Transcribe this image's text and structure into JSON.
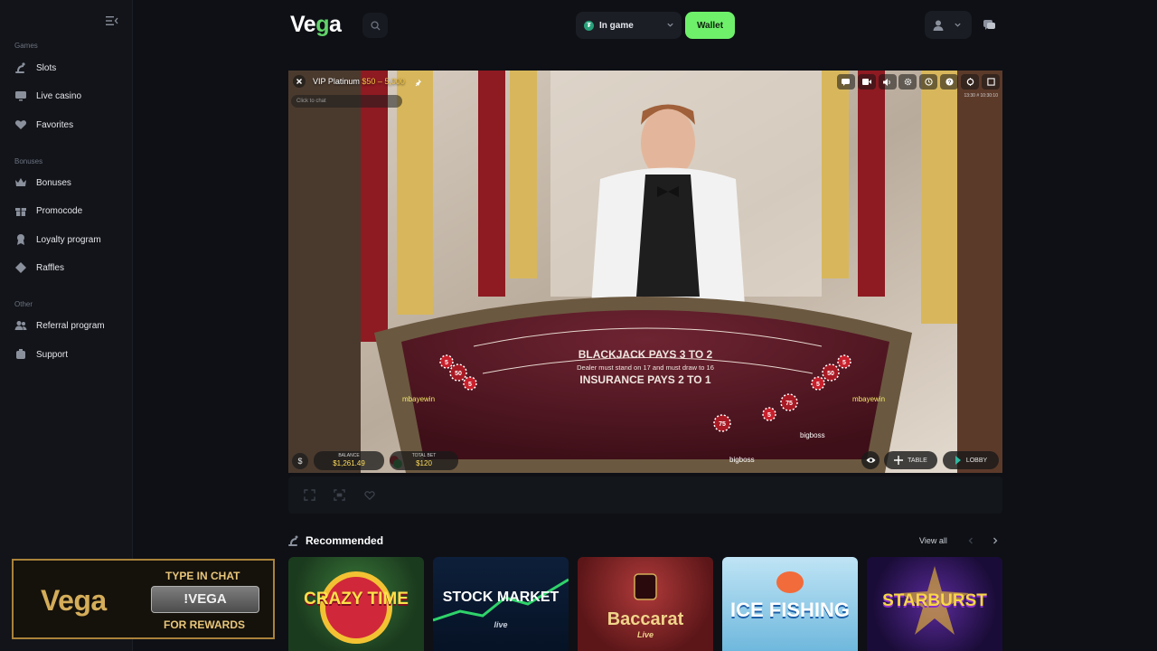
{
  "sidebar": {
    "sections": [
      {
        "label": "Games",
        "items": [
          {
            "label": "Slots",
            "icon": "slots-icon"
          },
          {
            "label": "Live casino",
            "icon": "live-casino-icon"
          },
          {
            "label": "Favorites",
            "icon": "heart-icon"
          }
        ]
      },
      {
        "label": "Bonuses",
        "items": [
          {
            "label": "Bonuses",
            "icon": "crown-icon"
          },
          {
            "label": "Promocode",
            "icon": "gift-icon"
          },
          {
            "label": "Loyalty program",
            "icon": "medal-icon"
          },
          {
            "label": "Raffles",
            "icon": "ticket-icon"
          }
        ]
      },
      {
        "label": "Other",
        "items": [
          {
            "label": "Referral program",
            "icon": "users-icon"
          },
          {
            "label": "Support",
            "icon": "support-icon"
          }
        ]
      }
    ]
  },
  "header": {
    "logo_prefix": "Ve",
    "logo_accent": "g",
    "logo_suffix": "a",
    "balance_selector": "In game",
    "wallet_label": "Wallet"
  },
  "game": {
    "table_name": "VIP Platinum",
    "limits": "$50 – 5,000",
    "chat_placeholder": "Click to chat",
    "time": "13:30 # 10:30:10",
    "felt_line1": "BLACKJACK PAYS 3 TO 2",
    "felt_line2": "Dealer must stand on 17 and must draw to 16",
    "felt_line3": "INSURANCE PAYS 2 TO 1",
    "players": [
      "mbayewin",
      "mbayewin",
      "bigboss",
      "bigboss"
    ],
    "chip_values": [
      "5",
      "50",
      "5",
      "5",
      "50",
      "5",
      "75",
      "5",
      "75"
    ],
    "balance_label": "BALANCE",
    "balance_value": "$1,261.49",
    "total_bet_label": "TOTAL BET",
    "total_bet_value": "$120",
    "table_button": "TABLE",
    "lobby_button": "LOBBY"
  },
  "recommended": {
    "title": "Recommended",
    "view_all": "View all",
    "games": [
      {
        "title": "CRAZY TIME"
      },
      {
        "title": "STOCK MARKET",
        "subtitle": "live"
      },
      {
        "title": "Baccarat",
        "subtitle": "Live"
      },
      {
        "title": "ICE FISHING"
      },
      {
        "title": "STARBURST"
      }
    ]
  },
  "promo": {
    "brand": "Vega",
    "line1": "TYPE IN CHAT",
    "command": "!VEGA",
    "line2": "FOR REWARDS"
  },
  "colors": {
    "accent": "#6ff06b",
    "background": "#0e1015",
    "gold": "#f5c542"
  }
}
